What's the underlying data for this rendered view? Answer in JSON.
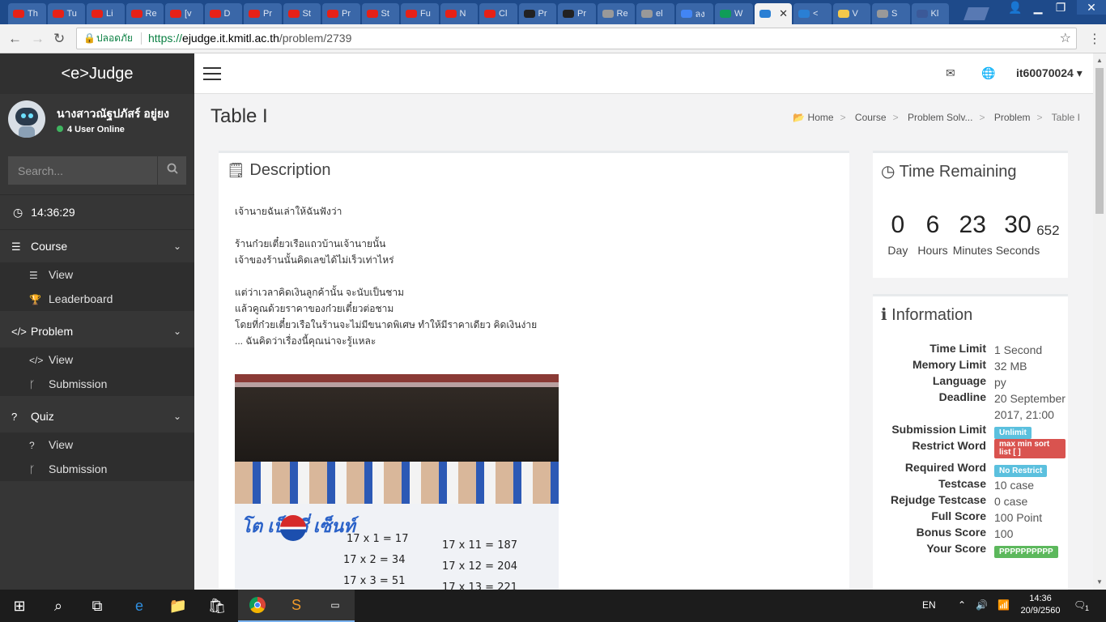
{
  "browser": {
    "tabs": [
      {
        "label": "Th",
        "icon": "youtube-icon"
      },
      {
        "label": "Tu",
        "icon": "youtube-icon"
      },
      {
        "label": "Li",
        "icon": "youtube-icon"
      },
      {
        "label": "Re",
        "icon": "youtube-icon"
      },
      {
        "label": "[v",
        "icon": "youtube-icon"
      },
      {
        "label": "D",
        "icon": "youtube-icon"
      },
      {
        "label": "Pr",
        "icon": "youtube-icon"
      },
      {
        "label": "St",
        "icon": "youtube-icon"
      },
      {
        "label": "Pr",
        "icon": "youtube-icon"
      },
      {
        "label": "St",
        "icon": "youtube-icon"
      },
      {
        "label": "Fu",
        "icon": "youtube-icon"
      },
      {
        "label": "N",
        "icon": "youtube-icon"
      },
      {
        "label": "Cl",
        "icon": "youtube-icon"
      },
      {
        "label": "Pr",
        "icon": "github-icon"
      },
      {
        "label": "Pr",
        "icon": "github-icon"
      },
      {
        "label": "Re",
        "icon": "page-icon"
      },
      {
        "label": "el",
        "icon": "page-icon"
      },
      {
        "label": "ลง",
        "icon": "google-icon"
      },
      {
        "label": "W",
        "icon": "drive-icon"
      },
      {
        "label": "",
        "icon": "ejudge-icon",
        "active": true
      },
      {
        "label": "<",
        "icon": "ejudge-icon"
      },
      {
        "label": "V",
        "icon": "python-icon"
      },
      {
        "label": "S",
        "icon": "page-icon"
      },
      {
        "label": "Kl",
        "icon": "facebook-icon"
      }
    ],
    "active_close": "✕",
    "secure_label": "ปลอดภัย",
    "url_scheme": "https://",
    "url_host": "ejudge.it.kmitl.ac.th",
    "url_path": "/problem/2739"
  },
  "sidebar": {
    "brand": "<e>Judge",
    "user_name": "นางสาวณัฐปภัสร์ อยู่ยง",
    "online": "4 User Online",
    "search_placeholder": "Search...",
    "time": "14:36:29",
    "sections": [
      {
        "label": "Course",
        "items": [
          "View",
          "Leaderboard"
        ]
      },
      {
        "label": "Problem",
        "items": [
          "View",
          "Submission"
        ]
      },
      {
        "label": "Quiz",
        "items": [
          "View",
          "Submission"
        ]
      }
    ]
  },
  "topbar": {
    "username": "it60070024"
  },
  "page": {
    "title": "Table I",
    "breadcrumb": [
      "Home",
      "Course",
      "Problem Solv...",
      "Problem",
      "Table I"
    ]
  },
  "description": {
    "title": "Description",
    "lines": [
      "เจ้านายฉันเล่าให้ฉันฟังว่า",
      "ร้านก๋วยเตี๋ยวเรือแถวบ้านเจ้านายนั้น",
      "เจ้าของร้านนั้นคิดเลขได้ไม่เร็วเท่าไหร่",
      "แต่ว่าเวลาคิดเงินลูกค้านั้น จะนับเป็นชาม",
      "แล้วคูณด้วยราคาของก๋วยเตี๋ยวต่อชาม",
      "โดยที่ก๋วยเตี๋ยวเรือในร้านจะไม่มีขนาดพิเศษ ทำให้มีราคาเดียว คิดเงินง่าย",
      "... ฉันคิดว่าเรื่องนี้คุณน่าจะรู้แหละ"
    ],
    "photo_text": {
      "brand": "โต เป็ปซี่ เซ็นท์",
      "rows": [
        "17 x 1  = 17",
        "17 x 2  = 34",
        "17 x 3  = 51",
        "17 x 11 = 187",
        "17 x 12 = 204",
        "17 x 13 = 221"
      ]
    }
  },
  "timer": {
    "title": "Time Remaining",
    "units": [
      {
        "value": "0",
        "label": "Day"
      },
      {
        "value": "6",
        "label": "Hours"
      },
      {
        "value": "23",
        "label": "Minutes"
      },
      {
        "value": "30",
        "label": "Seconds"
      }
    ],
    "ms": "652"
  },
  "info": {
    "title": "Information",
    "time_limit": "1 Second",
    "memory_limit": "32 MB",
    "language": "py",
    "deadline": "20 September 2017, 21:00",
    "submission_limit": "Unlimit",
    "restrict_word": "max min sort list [ ]",
    "required_word": "No Restrict",
    "testcase": "10 case",
    "rejudge_testcase": "0 case",
    "full_score": "100 Point",
    "bonus_score": "100",
    "your_score": "PPPPPPPPPP",
    "labels": {
      "time_limit": "Time Limit",
      "memory_limit": "Memory Limit",
      "language": "Language",
      "deadline": "Deadline",
      "submission_limit": "Submission Limit",
      "restrict_word": "Restrict Word",
      "required_word": "Required Word",
      "testcase": "Testcase",
      "rejudge_testcase": "Rejudge Testcase",
      "full_score": "Full Score",
      "bonus_score": "Bonus Score",
      "your_score": "Your Score"
    }
  },
  "taskbar": {
    "lang": "EN",
    "time": "14:36",
    "date": "20/9/2560",
    "notifications": "1"
  },
  "colors": {
    "sidebar_bg": "#363636",
    "badge_blue": "#5bc0de",
    "badge_red": "#d9534f",
    "badge_green": "#5cb85c",
    "secure_green": "#0b8043"
  }
}
